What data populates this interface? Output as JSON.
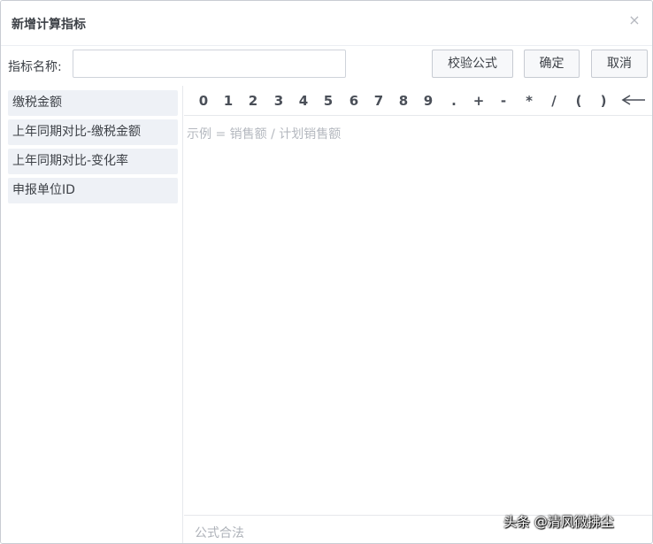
{
  "dialog": {
    "title": "新增计算指标",
    "close_glyph": "×"
  },
  "name_row": {
    "label": "指标名称:",
    "input_value": "",
    "buttons": {
      "validate": "校验公式",
      "confirm": "确定",
      "cancel": "取消"
    }
  },
  "fields": [
    {
      "label": "缴税金额"
    },
    {
      "label": "上年同期对比-缴税金额"
    },
    {
      "label": "上年同期对比-变化率"
    },
    {
      "label": "申报单位ID"
    }
  ],
  "operators": [
    "0",
    "1",
    "2",
    "3",
    "4",
    "5",
    "6",
    "7",
    "8",
    "9",
    ".",
    "+",
    "-",
    "*",
    "/",
    "(",
    ")"
  ],
  "backspace_icon": "backspace-arrow-icon",
  "editor": {
    "placeholder": "示例 = 销售额 / 计划销售额"
  },
  "status": {
    "text": "公式合法"
  },
  "watermark": "头条 @清风微拂尘"
}
